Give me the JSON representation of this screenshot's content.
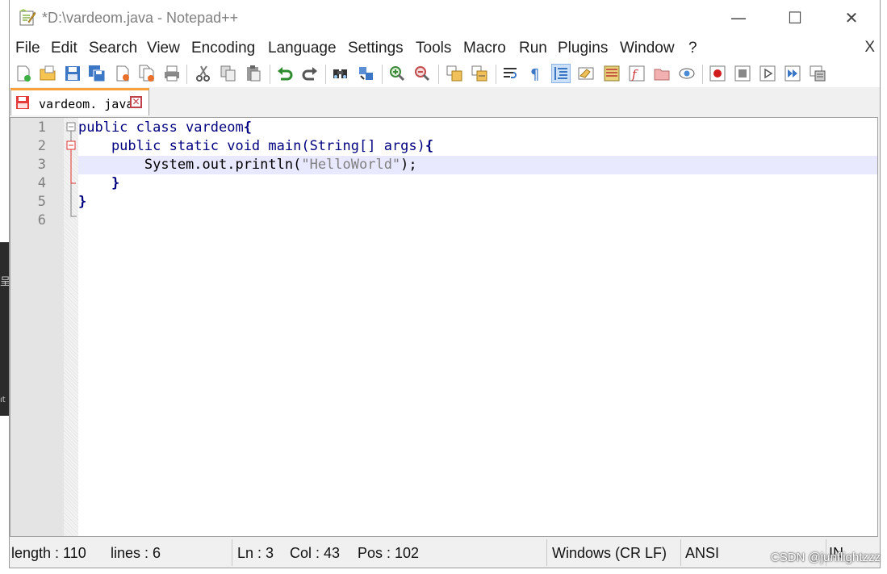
{
  "window": {
    "title": "*D:\\vardeom.java - Notepad++",
    "minimize_glyph": "—",
    "maximize_glyph": "☐",
    "close_glyph": "✕"
  },
  "background": {
    "glyph_1": "呈",
    "glyph_2": "ıt"
  },
  "menu": {
    "items": [
      "File",
      "Edit",
      "Search",
      "View",
      "Encoding",
      "Language",
      "Settings",
      "Tools",
      "Macro",
      "Run",
      "Plugins",
      "Window",
      "?"
    ],
    "close_doc": "X"
  },
  "toolbar": {
    "icons": [
      "new-file-icon",
      "open-file-icon",
      "save-icon",
      "save-all-icon",
      "close-icon",
      "close-all-icon",
      "print-icon",
      "cut-icon",
      "copy-icon",
      "paste-icon",
      "undo-icon",
      "redo-icon",
      "find-icon",
      "replace-icon",
      "zoom-in-icon",
      "zoom-out-icon",
      "sync-vertical-icon",
      "sync-horizontal-icon",
      "word-wrap-icon",
      "show-all-chars-icon",
      "indent-guide-icon",
      "language-define-icon",
      "doc-map-icon",
      "function-list-icon",
      "folder-workspace-icon",
      "monitoring-icon",
      "record-macro-icon",
      "stop-record-icon",
      "play-macro-icon",
      "run-macro-multiple-icon",
      "save-macro-icon"
    ]
  },
  "tab": {
    "label": "vardeom. java",
    "close_glyph": "✕"
  },
  "editor": {
    "line_numbers": [
      "1",
      "2",
      "3",
      "4",
      "5",
      "6"
    ],
    "current_line": 3,
    "lines": [
      [
        "public class vardeom",
        "{"
      ],
      [
        "    public static void main(String[] args)",
        "{"
      ],
      [
        "        System.out.println(",
        "\"HelloWorld\"",
        ");"
      ],
      [
        "    }"
      ],
      [
        "}"
      ],
      [
        ""
      ]
    ]
  },
  "status": {
    "length": "length : 110",
    "lines": "lines : 6",
    "ln": "Ln : 3",
    "col": "Col : 43",
    "pos": "Pos : 102",
    "eol": "Windows (CR LF)",
    "encoding": "ANSI",
    "mode": "IN",
    "watermark": "CSDN @junflightzzz"
  },
  "colors": {
    "keyword": "#000080",
    "string": "#808080",
    "current_line": "#e8e8ff",
    "tab_accent": "#f9a13b"
  }
}
